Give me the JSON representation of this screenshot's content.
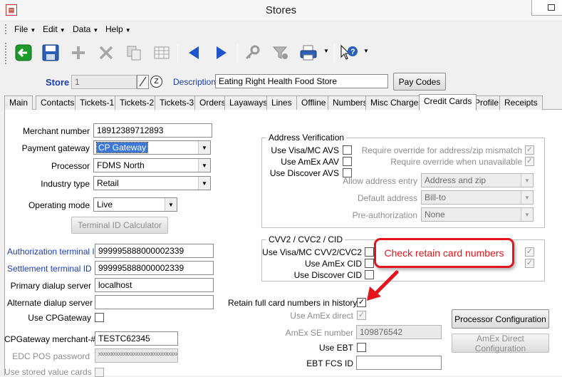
{
  "window": {
    "title": "Stores",
    "app_icon": "app-icon"
  },
  "menu": [
    {
      "label": "File"
    },
    {
      "label": "Edit"
    },
    {
      "label": "Data"
    },
    {
      "label": "Help"
    }
  ],
  "toolbar": {
    "icons": [
      "back-icon",
      "save-icon",
      "add-icon",
      "delete-icon",
      "copy-icon",
      "grid-icon",
      "previous-icon",
      "next-icon",
      "search-key-icon",
      "filter-icon",
      "print-icon",
      "help-cursor-icon"
    ]
  },
  "store_row": {
    "store_label": "Store",
    "store_value": "1",
    "description_label": "Description",
    "description_value": "Eating Right Health Food Store",
    "pay_codes_button": "Pay Codes"
  },
  "tabs": [
    "Main",
    "Contacts",
    "Tickets-1",
    "Tickets-2",
    "Tickets-3",
    "Orders",
    "Layaways",
    "Lines",
    "Offline",
    "Numbers",
    "Misc Charges",
    "Credit Cards",
    "Profile",
    "Receipts"
  ],
  "active_tab": "Credit Cards",
  "left": {
    "merchant_number_label": "Merchant number",
    "merchant_number": "18912389712893",
    "payment_gateway_label": "Payment gateway",
    "payment_gateway": "CP Gateway",
    "processor_label": "Processor",
    "processor": "FDMS North",
    "industry_type_label": "Industry type",
    "industry_type": "Retail",
    "operating_mode_label": "Operating mode",
    "operating_mode": "Live",
    "terminal_id_button": "Terminal ID Calculator",
    "auth_terminal_label": "Authorization terminal ID",
    "auth_terminal": "999995888000002339",
    "settle_terminal_label": "Settlement terminal ID",
    "settle_terminal": "999995888000002339",
    "primary_dialup_label": "Primary dialup server",
    "primary_dialup": "localhost",
    "alternate_dialup_label": "Alternate dialup server",
    "alternate_dialup": "",
    "use_cpgateway_label": "Use CPGateway",
    "cpgateway_merchant_label": "CPGateway merchant-#",
    "cpgateway_merchant": "TESTC62345",
    "edc_pos_password_label": "EDC POS password",
    "edc_pos_password": "xxxxxxxxxxxxxxxxxxxxxxxxxxxxxxxx",
    "use_stored_value_label": "Use stored value cards"
  },
  "address_verification": {
    "title": "Address Verification",
    "use_visa_avs": "Use Visa/MC AVS",
    "use_amex_aav": "Use AmEx AAV",
    "use_discover_avs": "Use Discover AVS",
    "require_override_mismatch": "Require override for address/zip mismatch",
    "require_override_unavailable": "Require override when unavailable",
    "allow_address_entry_label": "Allow address entry",
    "allow_address_entry": "Address and zip",
    "default_address_label": "Default address",
    "default_address": "Bill-to",
    "preauth_label": "Pre-authorization",
    "preauth": "None"
  },
  "cvv": {
    "title": "CVV2 / CVC2 / CID",
    "use_visa_cvv": "Use Visa/MC CVV2/CVC2",
    "use_amex_cid": "Use AmEx CID",
    "use_discover_cid": "Use Discover CID"
  },
  "callout": {
    "text": "Check retain card numbers",
    "accent": "#e3141b"
  },
  "bottom_right": {
    "retain_full_label": "Retain full card numbers in history",
    "use_amex_direct_label": "Use AmEx direct",
    "amex_se_number_label": "AmEx SE number",
    "amex_se_number": "109876542",
    "use_ebt_label": "Use EBT",
    "ebt_fcs_id_label": "EBT FCS ID",
    "ebt_fcs_id": "",
    "processor_config_button": "Processor Configuration",
    "amex_direct_config_button": "AmEx Direct Configuration"
  }
}
